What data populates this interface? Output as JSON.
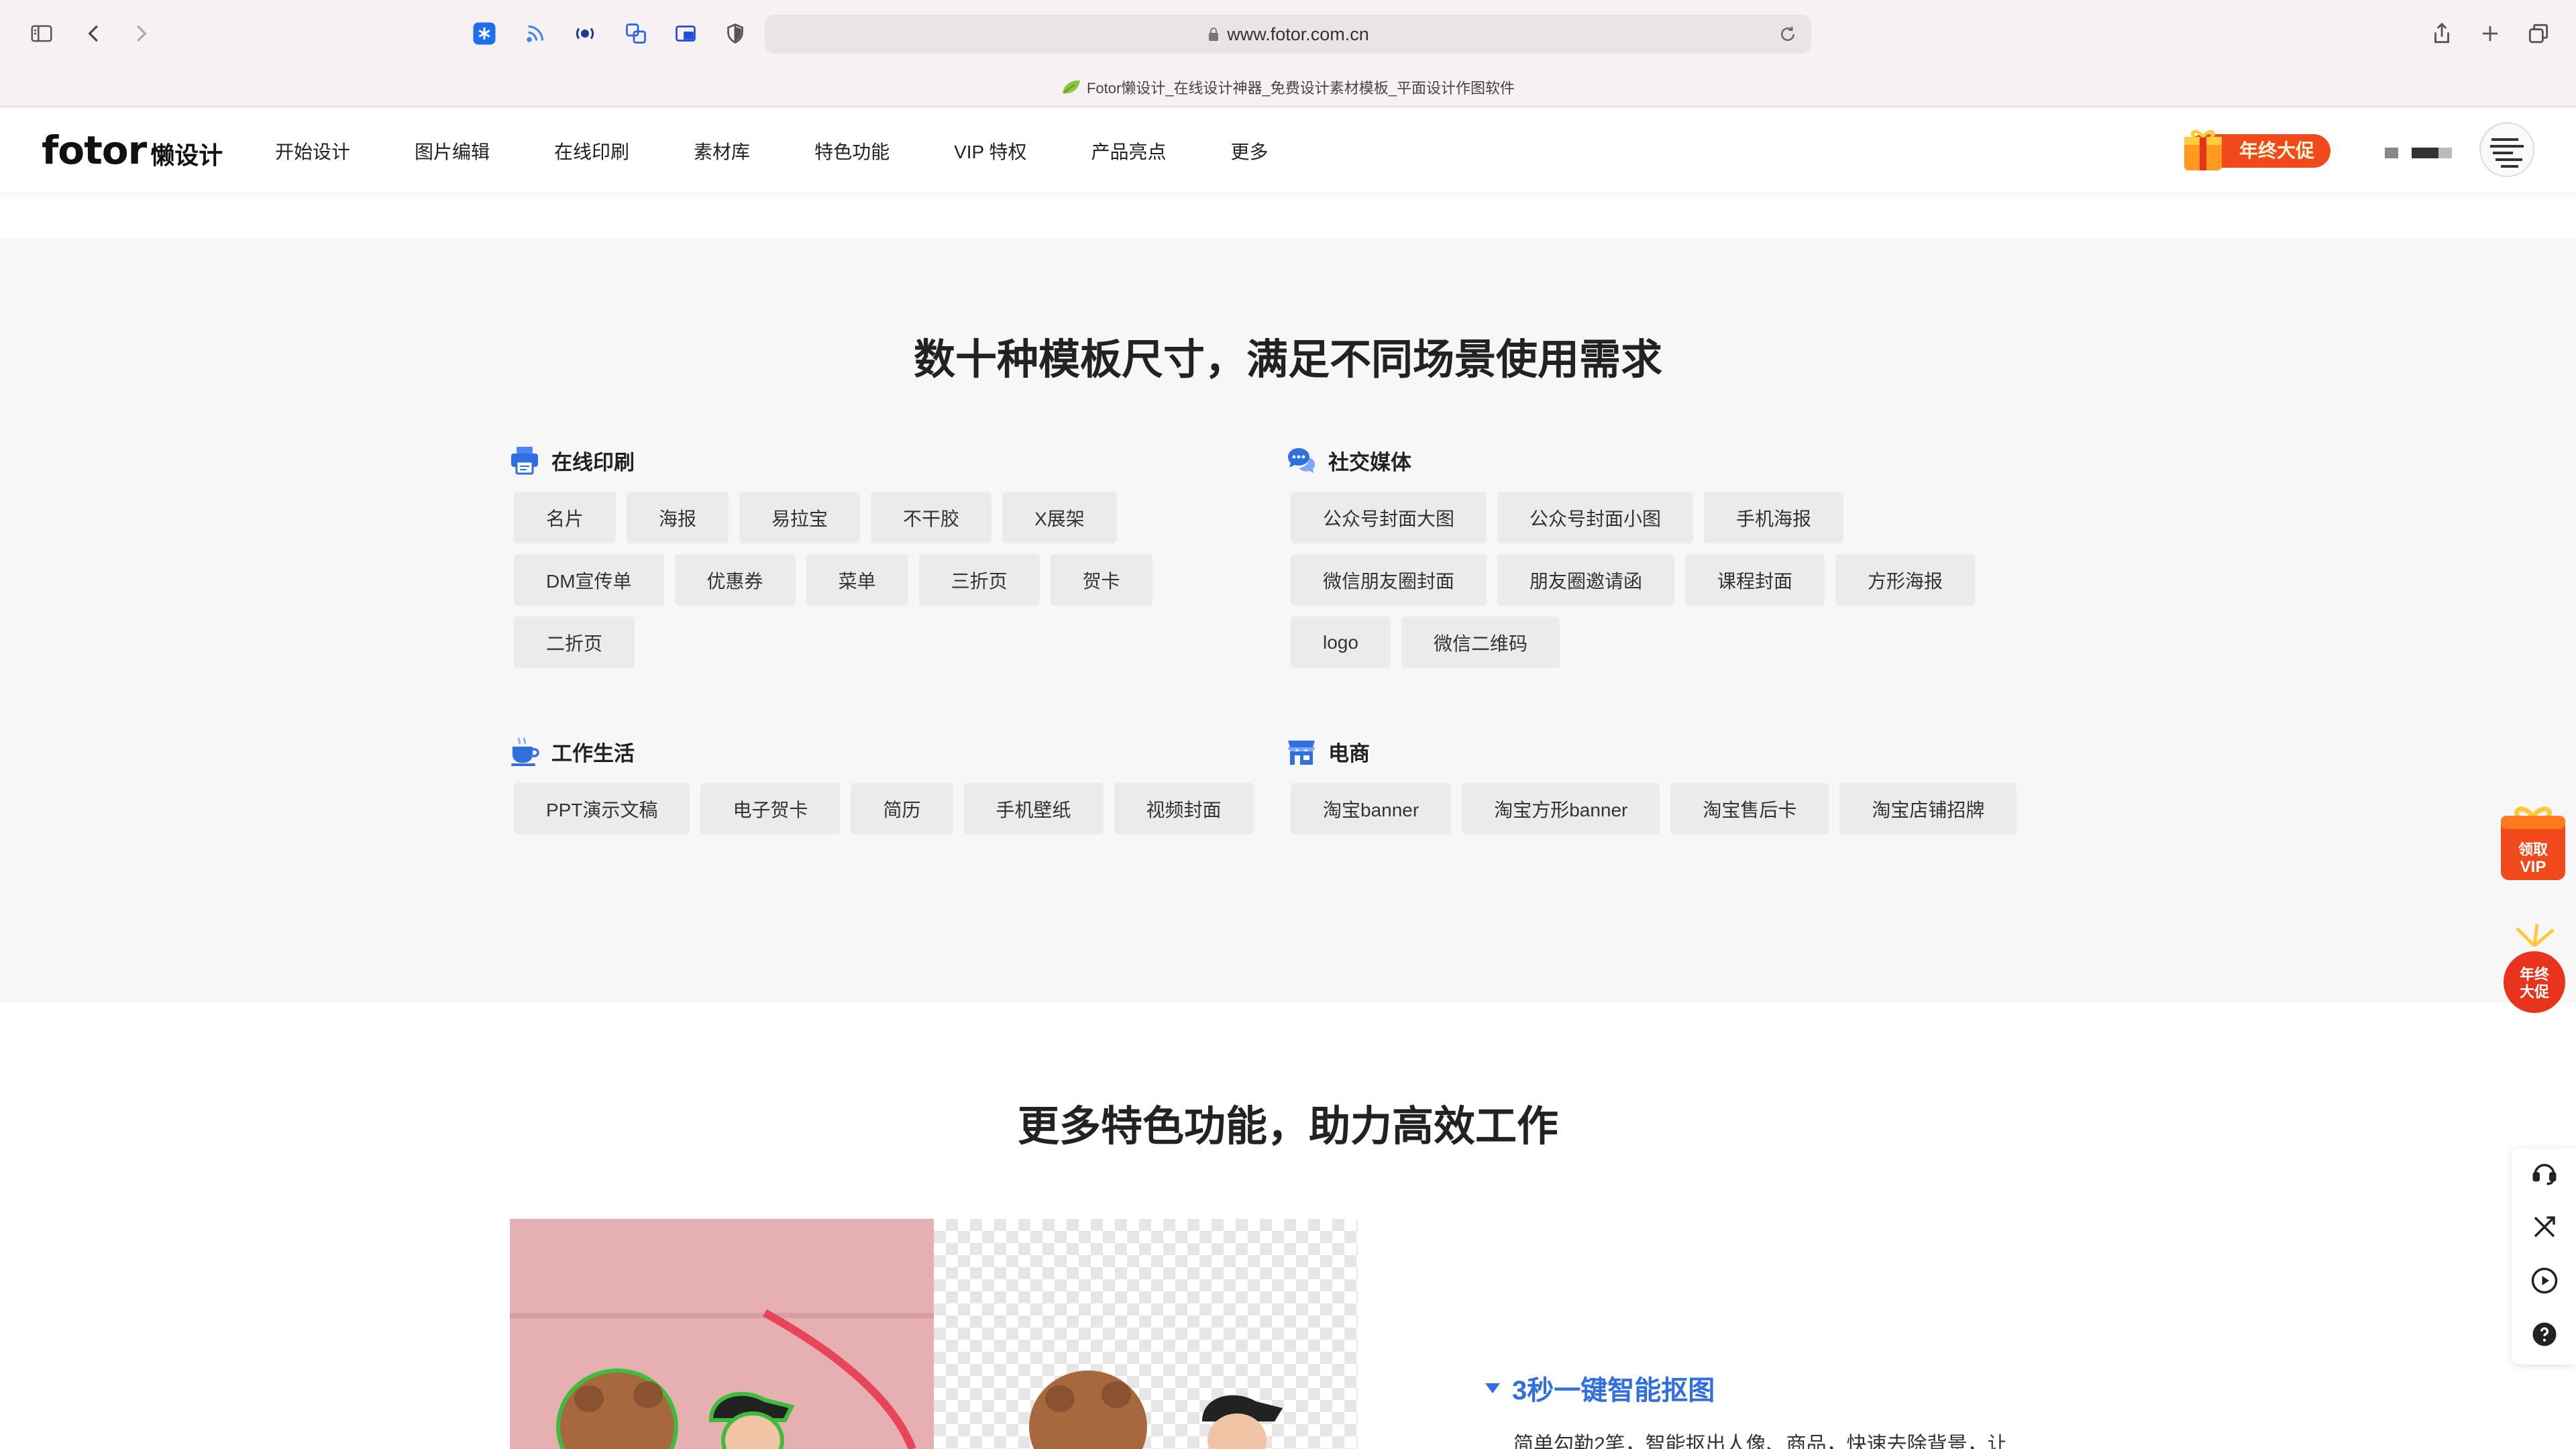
{
  "browser": {
    "url": "www.fotor.com.cn",
    "tab_title": "Fotor懒设计_在线设计神器_免费设计素材模板_平面设计作图软件"
  },
  "header": {
    "logo_main": "fotor",
    "logo_sub": "懒设计",
    "nav": [
      {
        "label": "开始设计"
      },
      {
        "label": "图片编辑"
      },
      {
        "label": "在线印刷"
      },
      {
        "label": "素材库"
      },
      {
        "label": "特色功能"
      },
      {
        "label": "VIP 特权"
      },
      {
        "label": "产品亮点"
      },
      {
        "label": "更多"
      }
    ],
    "promo_badge": "年终大促"
  },
  "templates": {
    "title": "数十种模板尺寸，满足不同场景使用需求",
    "categories": [
      {
        "title": "在线印刷",
        "icon": "printer-icon",
        "tags": [
          "名片",
          "海报",
          "易拉宝",
          "不干胶",
          "X展架",
          "DM宣传单",
          "优惠券",
          "菜单",
          "三折页",
          "贺卡",
          "二折页"
        ]
      },
      {
        "title": "社交媒体",
        "icon": "chat-bubbles-icon",
        "tags": [
          "公众号封面大图",
          "公众号封面小图",
          "手机海报",
          "微信朋友圈封面",
          "朋友圈邀请函",
          "课程封面",
          "方形海报",
          "logo",
          "微信二维码"
        ]
      },
      {
        "title": "工作生活",
        "icon": "coffee-cup-icon",
        "tags": [
          "PPT演示文稿",
          "电子贺卡",
          "简历",
          "手机壁纸",
          "视频封面"
        ]
      },
      {
        "title": "电商",
        "icon": "storefront-icon",
        "tags": [
          "淘宝banner",
          "淘宝方形banner",
          "淘宝售后卡",
          "淘宝店铺招牌"
        ]
      }
    ]
  },
  "features": {
    "title": "更多特色功能，助力高效工作",
    "items": [
      {
        "title": "3秒一键智能抠图",
        "desc": "简单勾勒2笔，智能抠出人像、商品，快速去除背景，让"
      }
    ]
  },
  "floating": {
    "vip_line1": "领取",
    "vip_line2": "VIP",
    "promo_line1": "年终",
    "promo_line2": "大促"
  },
  "colors": {
    "accent_blue": "#2f6fe0",
    "promo_red": "#e8341c",
    "tag_bg": "#ebebeb",
    "section_bg": "#f7f7f7"
  }
}
